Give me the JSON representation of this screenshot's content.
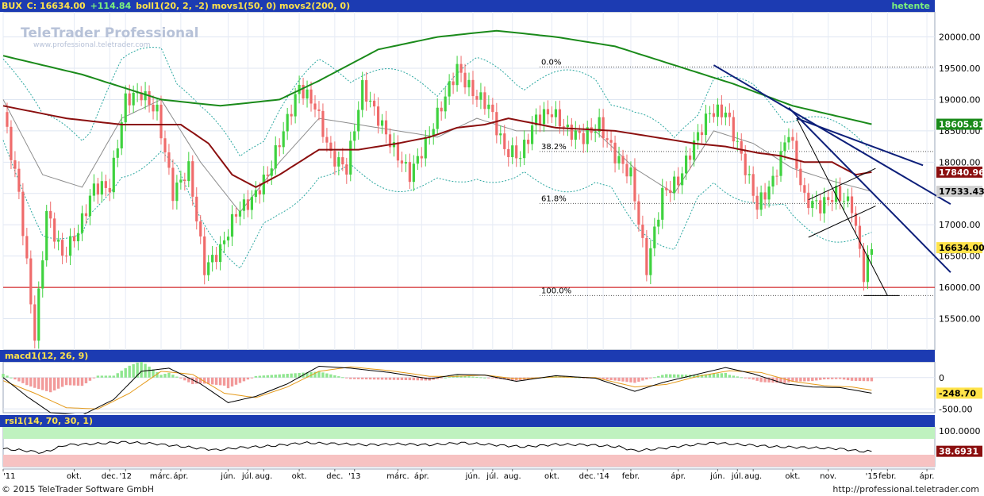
{
  "header": {
    "symbol": "BUX",
    "close_label": "C: 16634.00",
    "change": "+114.84",
    "indicators": "boll1(20, 2, -2) movs1(50, 0) movs2(200, 0)",
    "period": "hetente"
  },
  "watermark": {
    "brand": "TeleTrader Professional",
    "url": "www.professional.teletrader.com"
  },
  "macd_panel": {
    "label": "macd1(12, 26, 9)"
  },
  "rsi_panel": {
    "label": "rsi1(14, 70, 30, 1)"
  },
  "footer": {
    "copyright": "© 2015 TeleTrader Software GmbH",
    "url": "http://professional.teletrader.com"
  },
  "colors": {
    "up": "#3fd23f",
    "down": "#ef6b6b",
    "sma50": "#8b0f0f",
    "sma200": "#1a8a1a",
    "trend": "#0d1f7a",
    "support": "#d00000",
    "bar": "#1c3bb2"
  },
  "chart_data": [
    {
      "type": "candlestick",
      "ylim": [
        15000,
        20400
      ],
      "yticks": [
        15500,
        16000,
        16500,
        17000,
        17500,
        18000,
        18500,
        19000,
        19500,
        20000
      ],
      "ytick_labels": [
        "15500.00",
        "16000.00",
        "16500.00",
        "17000.00",
        "17500.00",
        "18000.00",
        "18500.00",
        "19000.00",
        "19500.00",
        "20000.00"
      ],
      "x_labels": [
        "'11",
        "okt.",
        "dec.",
        "'12",
        "márc.",
        "ápr.",
        "jún.",
        "júl.",
        "aug.",
        "okt.",
        "dec.",
        "'13",
        "márc.",
        "ápr.",
        "jún.",
        "júl.",
        "aug.",
        "okt.",
        "dec.",
        "'14",
        "febr.",
        "ápr.",
        "jún.",
        "júl.",
        "aug.",
        "okt.",
        "nov.",
        "'15",
        "febr.",
        "ápr."
      ],
      "x_label_weeks": [
        0,
        18,
        27,
        31,
        40,
        45,
        57,
        62,
        66,
        75,
        84,
        89,
        100,
        106,
        119,
        124,
        129,
        139,
        148,
        152,
        159,
        171,
        181,
        186,
        190,
        200,
        209,
        220,
        224,
        234
      ],
      "last_value_labels": [
        {
          "value": 18605.81,
          "text": "18605.81",
          "series": "sma200"
        },
        {
          "value": 17840.96,
          "text": "17840.96",
          "series": "sma50"
        },
        {
          "value": 17533.43,
          "text": "17533.43",
          "series": "bollinger"
        },
        {
          "value": 16634.0,
          "text": "16634.00",
          "series": "close"
        }
      ],
      "fibonacci": [
        {
          "label": "0.0%",
          "value": 19520
        },
        {
          "label": "38.2%",
          "value": 18170
        },
        {
          "label": "61.8%",
          "value": 17340
        },
        {
          "label": "100.0%",
          "value": 15870
        }
      ],
      "support_line": 16000,
      "close_anchors": [
        [
          0,
          18800
        ],
        [
          4,
          17500
        ],
        [
          8,
          15200
        ],
        [
          11,
          17200
        ],
        [
          15,
          16500
        ],
        [
          19,
          16900
        ],
        [
          23,
          17600
        ],
        [
          27,
          17600
        ],
        [
          31,
          19000
        ],
        [
          35,
          19100
        ],
        [
          39,
          18800
        ],
        [
          43,
          17500
        ],
        [
          47,
          17900
        ],
        [
          51,
          16300
        ],
        [
          55,
          16600
        ],
        [
          59,
          17200
        ],
        [
          63,
          17400
        ],
        [
          67,
          17800
        ],
        [
          71,
          18500
        ],
        [
          75,
          19200
        ],
        [
          79,
          18900
        ],
        [
          83,
          18100
        ],
        [
          87,
          17900
        ],
        [
          91,
          19200
        ],
        [
          95,
          18700
        ],
        [
          99,
          18200
        ],
        [
          103,
          17800
        ],
        [
          107,
          18300
        ],
        [
          111,
          18900
        ],
        [
          115,
          19500
        ],
        [
          119,
          19100
        ],
        [
          123,
          18900
        ],
        [
          127,
          18200
        ],
        [
          131,
          18100
        ],
        [
          135,
          18700
        ],
        [
          139,
          18800
        ],
        [
          143,
          18500
        ],
        [
          147,
          18400
        ],
        [
          151,
          18600
        ],
        [
          155,
          18100
        ],
        [
          159,
          17800
        ],
        [
          163,
          16300
        ],
        [
          167,
          17500
        ],
        [
          171,
          17700
        ],
        [
          175,
          18300
        ],
        [
          179,
          18800
        ],
        [
          183,
          18800
        ],
        [
          187,
          18100
        ],
        [
          191,
          17300
        ],
        [
          195,
          17700
        ],
        [
          199,
          18500
        ],
        [
          203,
          17400
        ],
        [
          207,
          17300
        ],
        [
          211,
          17500
        ],
        [
          215,
          17300
        ],
        [
          218,
          16200
        ],
        [
          220,
          16634
        ]
      ],
      "sma50_anchors": [
        [
          0,
          18900
        ],
        [
          16,
          18700
        ],
        [
          30,
          18600
        ],
        [
          45,
          18600
        ],
        [
          52,
          18300
        ],
        [
          58,
          17800
        ],
        [
          64,
          17600
        ],
        [
          70,
          17800
        ],
        [
          80,
          18200
        ],
        [
          90,
          18200
        ],
        [
          100,
          18300
        ],
        [
          108,
          18400
        ],
        [
          115,
          18550
        ],
        [
          122,
          18600
        ],
        [
          128,
          18700
        ],
        [
          140,
          18550
        ],
        [
          155,
          18500
        ],
        [
          165,
          18400
        ],
        [
          175,
          18300
        ],
        [
          183,
          18250
        ],
        [
          191,
          18150
        ],
        [
          197,
          18100
        ],
        [
          203,
          18000
        ],
        [
          210,
          18000
        ],
        [
          216,
          17800
        ],
        [
          220,
          17841
        ]
      ],
      "sma200_anchors": [
        [
          0,
          19700
        ],
        [
          20,
          19400
        ],
        [
          40,
          19000
        ],
        [
          55,
          18900
        ],
        [
          70,
          19000
        ],
        [
          80,
          19300
        ],
        [
          95,
          19800
        ],
        [
          110,
          20000
        ],
        [
          125,
          20100
        ],
        [
          140,
          20000
        ],
        [
          155,
          19850
        ],
        [
          170,
          19550
        ],
        [
          185,
          19250
        ],
        [
          200,
          18900
        ],
        [
          220,
          18606
        ]
      ],
      "bollinger_mid_anchors": [
        [
          0,
          19000
        ],
        [
          10,
          17800
        ],
        [
          20,
          17600
        ],
        [
          30,
          18700
        ],
        [
          40,
          19000
        ],
        [
          50,
          18000
        ],
        [
          60,
          17200
        ],
        [
          70,
          18000
        ],
        [
          80,
          18700
        ],
        [
          90,
          18600
        ],
        [
          100,
          18500
        ],
        [
          110,
          18400
        ],
        [
          120,
          18700
        ],
        [
          130,
          18500
        ],
        [
          140,
          18500
        ],
        [
          150,
          18500
        ],
        [
          160,
          17900
        ],
        [
          170,
          17500
        ],
        [
          180,
          18500
        ],
        [
          190,
          18300
        ],
        [
          200,
          17900
        ],
        [
          210,
          17700
        ],
        [
          220,
          17533
        ]
      ],
      "trend_lines": [
        {
          "from": [
            180,
            19550
          ],
          "to": [
            240,
            17330
          ]
        },
        {
          "from": [
            199,
            18870
          ],
          "to": [
            240,
            16240
          ]
        },
        {
          "from": [
            201,
            18700
          ],
          "to": [
            233,
            17950
          ]
        }
      ],
      "channel_lines": [
        {
          "from": [
            204,
            17400
          ],
          "to": [
            221,
            17900
          ]
        },
        {
          "from": [
            204,
            16800
          ],
          "to": [
            221,
            17300
          ]
        }
      ],
      "channel_down": {
        "from": [
          201,
          18700
        ],
        "to": [
          224,
          15870
        ]
      }
    },
    {
      "type": "macd",
      "ylim": [
        -560,
        250
      ],
      "yticks": [
        0,
        -500
      ],
      "ytick_labels": [
        "0",
        "-500.00"
      ],
      "last_value_labels": [
        {
          "value": -248.7,
          "text": "-248.70"
        }
      ],
      "macd_anchors": [
        [
          0,
          0
        ],
        [
          6,
          -300
        ],
        [
          12,
          -560
        ],
        [
          20,
          -600
        ],
        [
          28,
          -350
        ],
        [
          35,
          100
        ],
        [
          42,
          150
        ],
        [
          50,
          -100
        ],
        [
          57,
          -400
        ],
        [
          64,
          -300
        ],
        [
          72,
          -100
        ],
        [
          80,
          180
        ],
        [
          88,
          150
        ],
        [
          98,
          80
        ],
        [
          108,
          -20
        ],
        [
          115,
          50
        ],
        [
          122,
          40
        ],
        [
          130,
          -60
        ],
        [
          140,
          30
        ],
        [
          150,
          -10
        ],
        [
          160,
          -220
        ],
        [
          167,
          -80
        ],
        [
          175,
          40
        ],
        [
          183,
          160
        ],
        [
          190,
          60
        ],
        [
          198,
          -100
        ],
        [
          205,
          -150
        ],
        [
          212,
          -160
        ],
        [
          220,
          -249
        ]
      ],
      "signal_anchors": [
        [
          0,
          -50
        ],
        [
          8,
          -250
        ],
        [
          16,
          -480
        ],
        [
          24,
          -500
        ],
        [
          32,
          -250
        ],
        [
          40,
          100
        ],
        [
          48,
          50
        ],
        [
          56,
          -250
        ],
        [
          64,
          -320
        ],
        [
          72,
          -150
        ],
        [
          80,
          100
        ],
        [
          88,
          170
        ],
        [
          98,
          110
        ],
        [
          108,
          20
        ],
        [
          115,
          20
        ],
        [
          122,
          40
        ],
        [
          130,
          -20
        ],
        [
          140,
          10
        ],
        [
          150,
          0
        ],
        [
          160,
          -150
        ],
        [
          168,
          -110
        ],
        [
          176,
          20
        ],
        [
          184,
          110
        ],
        [
          192,
          80
        ],
        [
          200,
          -60
        ],
        [
          208,
          -130
        ],
        [
          215,
          -150
        ],
        [
          220,
          -200
        ]
      ]
    },
    {
      "type": "rsi",
      "ylim": [
        0,
        100
      ],
      "yticks": [
        100
      ],
      "ytick_labels": [
        "100.0000"
      ],
      "zones": {
        "overbought": 70,
        "oversold": 30
      },
      "last_value_labels": [
        {
          "value": 38.6931,
          "text": "38.6931"
        }
      ],
      "rsi_anchors": [
        [
          0,
          45
        ],
        [
          6,
          40
        ],
        [
          10,
          35
        ],
        [
          16,
          55
        ],
        [
          24,
          58
        ],
        [
          30,
          62
        ],
        [
          38,
          58
        ],
        [
          46,
          50
        ],
        [
          54,
          42
        ],
        [
          60,
          48
        ],
        [
          68,
          52
        ],
        [
          76,
          60
        ],
        [
          84,
          58
        ],
        [
          92,
          55
        ],
        [
          100,
          57
        ],
        [
          108,
          55
        ],
        [
          116,
          60
        ],
        [
          124,
          55
        ],
        [
          132,
          50
        ],
        [
          140,
          56
        ],
        [
          148,
          55
        ],
        [
          156,
          50
        ],
        [
          160,
          40
        ],
        [
          166,
          45
        ],
        [
          172,
          52
        ],
        [
          180,
          60
        ],
        [
          188,
          55
        ],
        [
          196,
          50
        ],
        [
          204,
          48
        ],
        [
          212,
          45
        ],
        [
          218,
          38
        ],
        [
          220,
          38.69
        ]
      ]
    }
  ]
}
